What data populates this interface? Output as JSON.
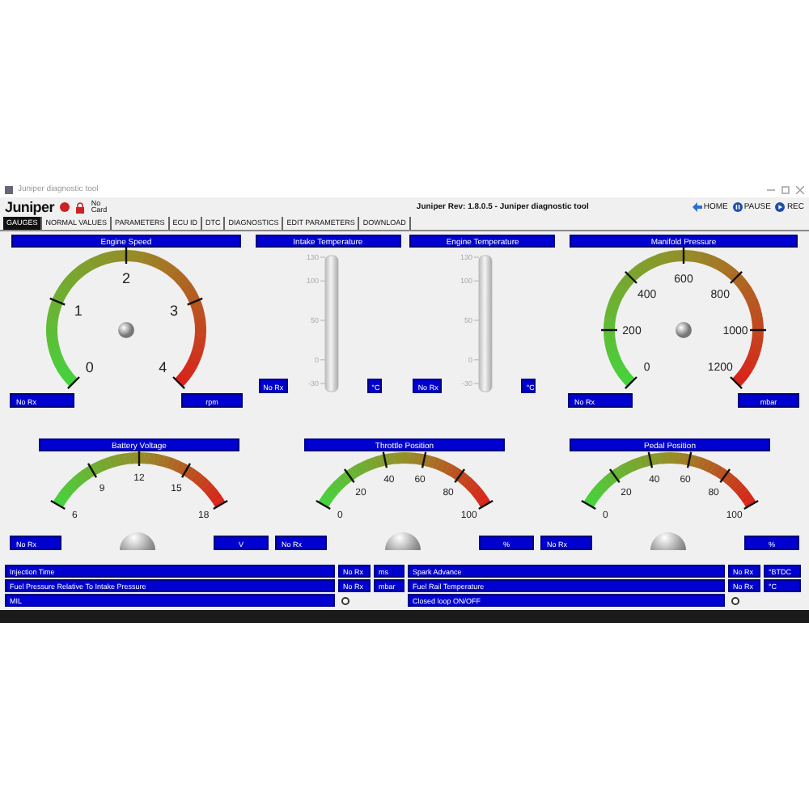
{
  "window": {
    "title": "Juniper diagnostic tool"
  },
  "header": {
    "logo": "Juniper",
    "card_status": "No Card",
    "title": "Juniper Rev: 1.8.0.5 - Juniper diagnostic tool"
  },
  "nav_buttons": [
    {
      "label": "HOME",
      "kind": "back"
    },
    {
      "label": "PAUSE",
      "kind": "pause"
    },
    {
      "label": "REC",
      "kind": "play"
    }
  ],
  "tabs": [
    {
      "label": "GAUGES",
      "selected": true
    },
    {
      "label": "NORMAL VALUES",
      "selected": false
    },
    {
      "label": "PARAMETERS",
      "selected": false
    },
    {
      "label": "ECU ID",
      "selected": false
    },
    {
      "label": "DTC",
      "selected": false
    },
    {
      "label": "DIAGNOSTICS",
      "selected": false
    },
    {
      "label": "EDIT PARAMETERS",
      "selected": false
    },
    {
      "label": "DOWNLOAD",
      "selected": false
    }
  ],
  "gauge_rows": [
    {
      "panels": [
        {
          "kind": "dial",
          "title": "Engine Speed",
          "scale": [
            "0",
            "1",
            "2",
            "3",
            "4"
          ],
          "reading": "No Rx",
          "unit": "rpm"
        },
        {
          "kind": "thermometer",
          "title": "Intake Temperature",
          "scale": [
            "130",
            "100",
            "50",
            "0",
            "-30"
          ],
          "reading": "No Rx",
          "unit": "°C"
        },
        {
          "kind": "thermometer",
          "title": "Engine Temperature",
          "scale": [
            "130",
            "100",
            "50",
            "0",
            "-30"
          ],
          "reading": "No Rx",
          "unit": "°C"
        },
        {
          "kind": "dial",
          "title": "Manifold Pressure",
          "scale": [
            "0",
            "200",
            "400",
            "600",
            "800",
            "1000",
            "1200"
          ],
          "reading": "No Rx",
          "unit": "mbar"
        }
      ]
    },
    {
      "panels": [
        {
          "kind": "arc",
          "title": "Battery Voltage",
          "scale": [
            "6",
            "9",
            "12",
            "15",
            "18"
          ],
          "reading": "No Rx",
          "unit": "V"
        },
        {
          "kind": "arc",
          "title": "Throttle Position",
          "scale": [
            "0",
            "20",
            "40",
            "60",
            "80",
            "100"
          ],
          "reading": "No Rx",
          "unit": "%"
        },
        {
          "kind": "arc",
          "title": "Pedal Position",
          "scale": [
            "0",
            "20",
            "40",
            "60",
            "80",
            "100"
          ],
          "reading": "No Rx",
          "unit": "%"
        }
      ]
    }
  ],
  "table": {
    "rows": [
      {
        "cells": [
          {
            "kind": "value",
            "label": "Injection Time",
            "value": "No Rx",
            "unit": "ms"
          },
          {
            "kind": "value",
            "label": "Spark Advance",
            "value": "No Rx",
            "unit": "°BTDC"
          }
        ]
      },
      {
        "cells": [
          {
            "kind": "value",
            "label": "Fuel Pressure Relative To Intake Pressure",
            "value": "No Rx",
            "unit": "mbar"
          },
          {
            "kind": "value",
            "label": "Fuel Rail Temperature",
            "value": "No Rx",
            "unit": "°C"
          }
        ]
      },
      {
        "cells": [
          {
            "kind": "indicator",
            "label": "MIL",
            "on": false
          },
          {
            "kind": "indicator",
            "label": "Closed loop ON/OFF",
            "on": false
          }
        ]
      }
    ]
  }
}
